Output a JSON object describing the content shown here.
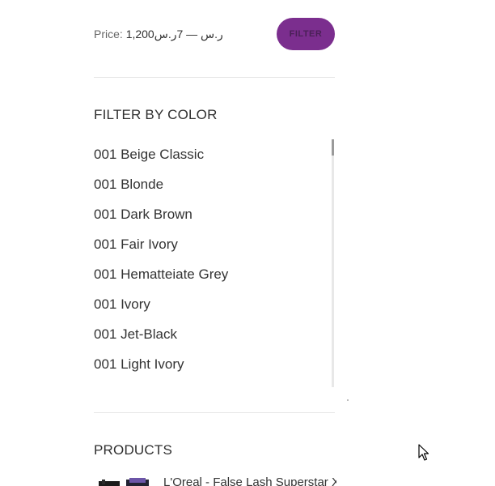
{
  "price_filter": {
    "label": "Price:",
    "range": "1,200ر.س — 7ر.س",
    "button_label": "FILTER",
    "button_color": "#7b2e8e"
  },
  "color_filter": {
    "title": "FILTER BY COLOR",
    "items": [
      "001 Beige Classic",
      "001 Blonde",
      "001 Dark Brown",
      "001 Fair Ivory",
      "001 Hematteiate Grey",
      "001 Ivory",
      "001 Jet-Black",
      "001 Light Ivory"
    ]
  },
  "products": {
    "title": "PRODUCTS",
    "items": [
      {
        "name": "L'Oreal - False Lash Superstar X"
      }
    ]
  }
}
